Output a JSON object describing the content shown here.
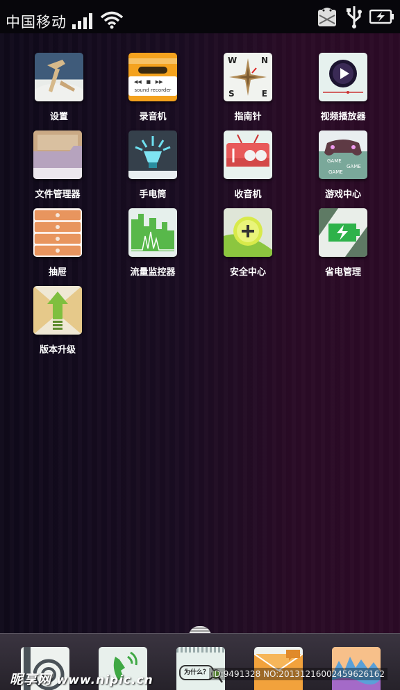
{
  "status_bar": {
    "carrier": "中国移动"
  },
  "apps": [
    {
      "label": "设置"
    },
    {
      "label": "录音机",
      "badge": "sound recorder"
    },
    {
      "label": "指南针",
      "compass": [
        "W",
        "N",
        "S",
        "E"
      ]
    },
    {
      "label": "视频播放器"
    },
    {
      "label": "文件管理器"
    },
    {
      "label": "手电筒"
    },
    {
      "label": "收音机"
    },
    {
      "label": "游戏中心",
      "game_text": "GAME"
    },
    {
      "label": "抽屉"
    },
    {
      "label": "流量监控器"
    },
    {
      "label": "安全中心"
    },
    {
      "label": "省电管理"
    },
    {
      "label": "版本升级"
    }
  ],
  "dock": {
    "message_bubble": "为什么？"
  },
  "watermark": {
    "brand": "昵享网",
    "url": "www.nipic.cn",
    "id": "ID:9491328 NO:20131216002459626162"
  },
  "colors": {
    "accent_green": "#8cc63f",
    "icon_bg": "#e8f2ee"
  }
}
